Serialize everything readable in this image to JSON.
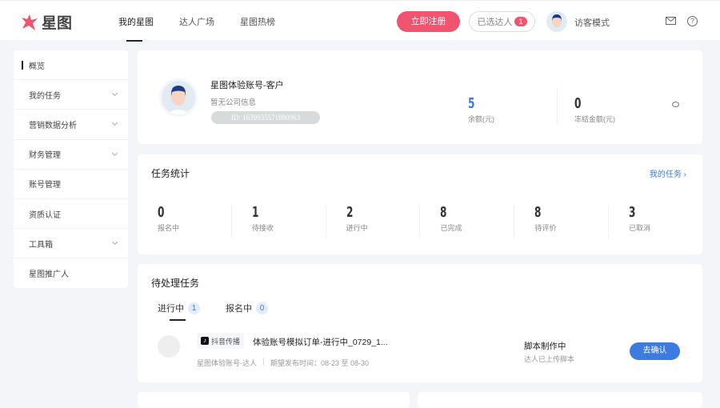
{
  "header": {
    "logo": "星图",
    "nav": [
      "我的星图",
      "达人广场",
      "星图热榜"
    ],
    "register": "立即注册",
    "selected": "已选达人",
    "selected_count": "1",
    "visitor": "访客模式"
  },
  "sidebar": {
    "items": [
      {
        "label": "概览"
      },
      {
        "label": "我的任务"
      },
      {
        "label": "营销数据分析"
      },
      {
        "label": "财务管理"
      },
      {
        "label": "账号管理"
      },
      {
        "label": "资质认证"
      },
      {
        "label": "工具箱"
      },
      {
        "label": "星图推广人"
      }
    ]
  },
  "account": {
    "name": "星图体验账号-客户",
    "company": "暂无公司信息",
    "id": "ID: 1639935571880963",
    "balance": "5",
    "balance_label": "余额(元)",
    "frozen": "0",
    "frozen_label": "冻结金额(元)"
  },
  "stats": {
    "title": "任务统计",
    "link": "我的任务",
    "items": [
      {
        "value": "0",
        "label": "报名中"
      },
      {
        "value": "1",
        "label": "待接收"
      },
      {
        "value": "2",
        "label": "进行中"
      },
      {
        "value": "8",
        "label": "已完成"
      },
      {
        "value": "8",
        "label": "待评价"
      },
      {
        "value": "3",
        "label": "已取消"
      }
    ]
  },
  "pending": {
    "title": "待处理任务",
    "tabs": [
      {
        "label": "进行中",
        "count": "1"
      },
      {
        "label": "报名中",
        "count": "0"
      }
    ],
    "task": {
      "platform": "抖音传播",
      "name": "体验账号模拟订单-进行中_0729_1...",
      "account": "星图体验账号-达人",
      "date": "期望发布时间：08-23 至 08-30",
      "status": "脚本制作中",
      "status_sub": "达人已上传脚本",
      "action": "去确认"
    }
  }
}
